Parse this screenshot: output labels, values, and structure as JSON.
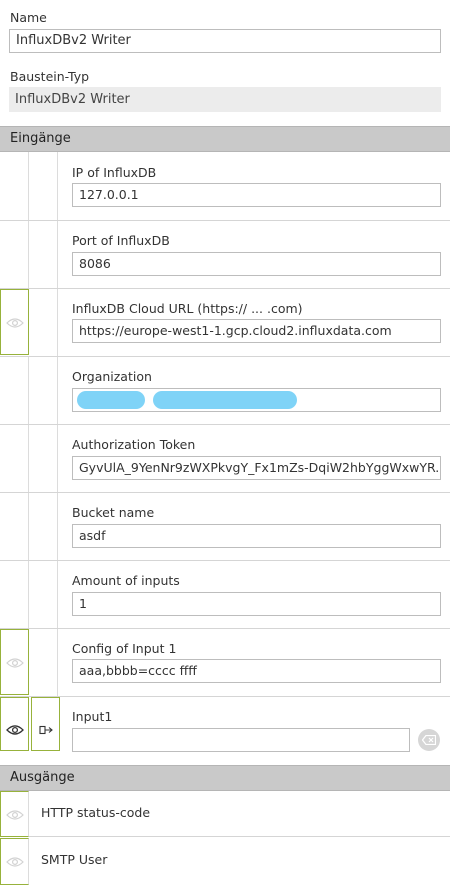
{
  "name": {
    "label": "Name",
    "value": "InfluxDBv2 Writer"
  },
  "block_type": {
    "label": "Baustein-Typ",
    "value": "InfluxDBv2 Writer"
  },
  "inputs_section": {
    "title": "Eingänge"
  },
  "inputs": [
    {
      "label": "IP of InfluxDB",
      "value": "127.0.0.1"
    },
    {
      "label": "Port of InfluxDB",
      "value": "8086"
    },
    {
      "label": "InfluxDB Cloud URL (https:// ... .com)",
      "value": "https://europe-west1-1.gcp.cloud2.influxdata.com"
    },
    {
      "label": "Organization",
      "value": "@"
    },
    {
      "label": "Authorization Token",
      "value": "GyvUlA_9YenNr9zWXPkvgY_Fx1mZs-DqiW2hbYggWxwYR..."
    },
    {
      "label": "Bucket name",
      "value": "asdf"
    },
    {
      "label": "Amount of inputs",
      "value": "1"
    },
    {
      "label": "Config of Input 1",
      "value": "aaa,bbbb=cccc ffff"
    },
    {
      "label": "Input1",
      "value": ""
    }
  ],
  "outputs_section": {
    "title": "Ausgänge"
  },
  "outputs": [
    {
      "label": "HTTP status-code"
    },
    {
      "label": "SMTP User"
    }
  ],
  "colors": {
    "accent": "#97b23b",
    "section_bg": "#c9c9c9",
    "redaction": "#7fd3f7"
  }
}
